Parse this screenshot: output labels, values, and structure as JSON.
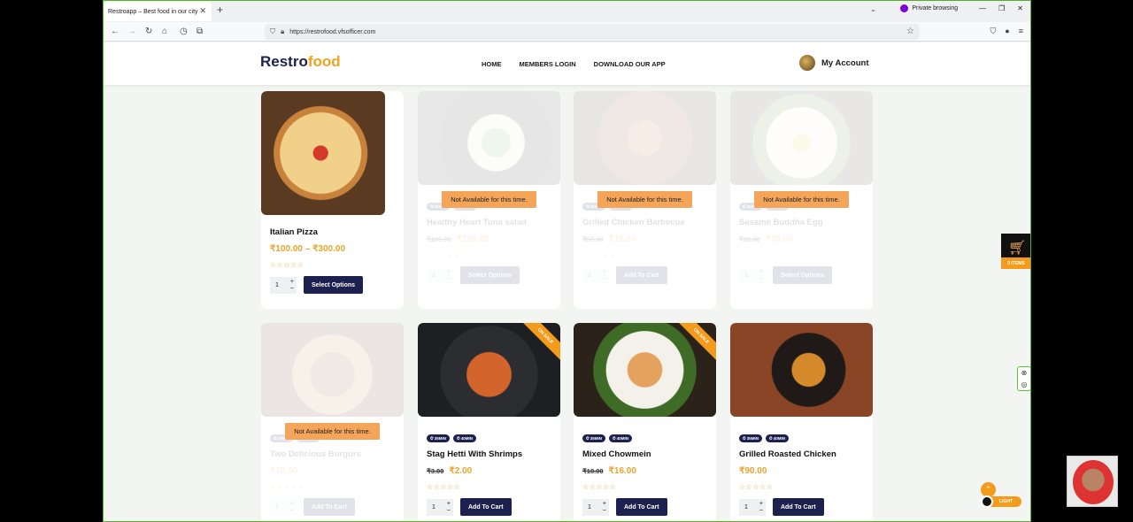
{
  "browser": {
    "tab_title": "Restroapp – Best food in our city",
    "tab_close": "✕",
    "new_tab": "+",
    "private_label": "Private browsing",
    "url": "https://restrofood.vfsofficer.com",
    "window_controls": [
      "—",
      "❐",
      "✕"
    ]
  },
  "site": {
    "logo_main": "Restro",
    "logo_accent": "food",
    "menu": [
      "HOME",
      "MEMBERS LOGIN",
      "DOWNLOAD OUR APP"
    ],
    "account_label": "My Account"
  },
  "products": [
    {
      "name": "Italian Pizza",
      "price": "₹100.00 – ₹300.00",
      "old_price": "",
      "available": true,
      "button": "Select Options",
      "qty": "1",
      "badges": [],
      "sale": false
    },
    {
      "name": "Healthy Heart Tuna salad",
      "price": "₹250.00",
      "old_price": "₹100.00",
      "available": false,
      "button": "Select Options",
      "qty": "1",
      "badges": [
        "35MIN",
        "40MIN"
      ],
      "sale": true,
      "not_available": "Not Available for this time."
    },
    {
      "name": "Grilled Chicken Barbecue",
      "price": "₹16.00",
      "old_price": "₹55.00",
      "available": false,
      "button": "Add To Cart",
      "qty": "1",
      "badges": [
        "35MIN",
        "40MIN"
      ],
      "sale": true,
      "not_available": "Not Available for this time."
    },
    {
      "name": "Sesame Buddha Egg",
      "price": "₹40.00",
      "old_price": "₹55.00",
      "available": false,
      "button": "Select Options",
      "qty": "1",
      "badges": [
        "35MIN",
        "40MIN"
      ],
      "sale": false,
      "not_available": "Not Available for this time."
    },
    {
      "name": "Two Delicious Burgurs",
      "price": "₹70.00",
      "old_price": "",
      "available": false,
      "button": "Add To Cart",
      "qty": "1",
      "badges": [
        "35MIN",
        "40MIN"
      ],
      "sale": false,
      "not_available": "Not Available for this time."
    },
    {
      "name": "Stag Hetti With Shrimps",
      "price": "₹2.00",
      "old_price": "₹3.00",
      "available": true,
      "button": "Add To Cart",
      "qty": "1",
      "badges": [
        "35MIN",
        "40MIN"
      ],
      "sale": true,
      "sale_label": "ON SALE"
    },
    {
      "name": "Mixed Chowmein",
      "price": "₹16.00",
      "old_price": "₹18.00",
      "available": true,
      "button": "Add To Cart",
      "qty": "1",
      "badges": [
        "35MIN",
        "40MIN"
      ],
      "sale": true,
      "sale_label": "ON SALE"
    },
    {
      "name": "Grilled Roasted Chicken",
      "price": "₹90.00",
      "old_price": "",
      "available": true,
      "button": "Add To Cart",
      "qty": "1",
      "badges": [
        "35MIN",
        "40MIN"
      ],
      "sale": false
    }
  ],
  "stars": "☆☆☆☆☆",
  "cart_float": {
    "label": "0 ITEMS"
  },
  "theme_toggle": {
    "label": "LIGHT"
  },
  "colors": {
    "brand_navy": "#1c2150",
    "accent_orange": "#f59b1c",
    "price_gold": "#e8a52e"
  }
}
